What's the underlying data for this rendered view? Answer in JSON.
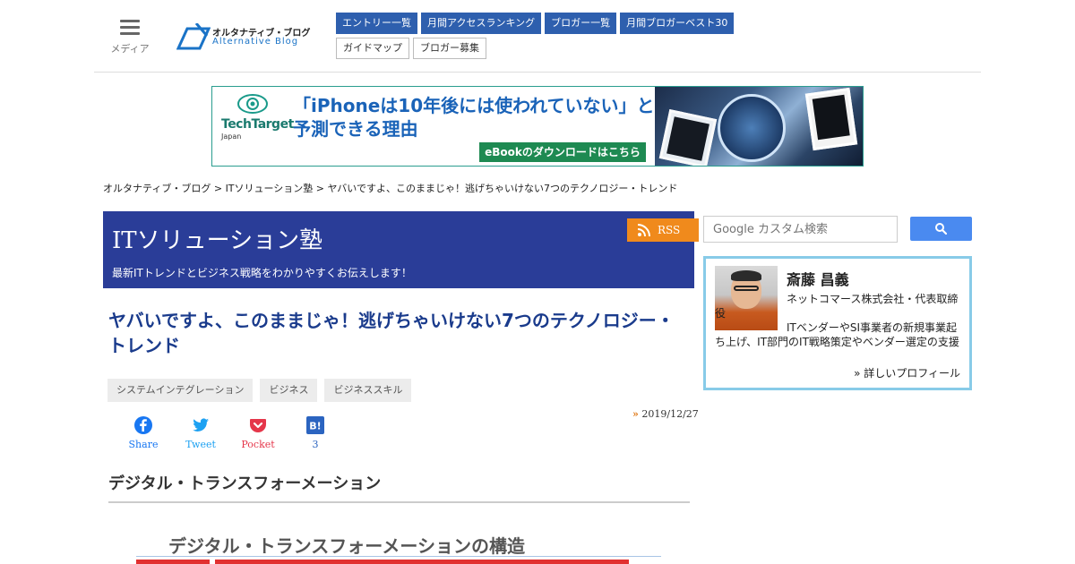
{
  "header": {
    "menu_label": "メディア",
    "logo_jp": "オルタナティブ・ブログ",
    "logo_en": "Alternative Blog",
    "nav_primary": [
      "エントリー一覧",
      "月間アクセスランキング",
      "ブロガー一覧",
      "月間ブロガーベスト30"
    ],
    "nav_secondary": [
      "ガイドマップ",
      "ブロガー募集"
    ]
  },
  "banner": {
    "brand": "TechTarget",
    "brand_sub": "Japan",
    "headline_line1": "「iPhoneは10年後には使われていない」と",
    "headline_line2": "予測できる理由",
    "cta": "eBookのダウンロードはこちら"
  },
  "breadcrumb": {
    "home": "オルタナティブ・ブログ",
    "sep": " > ",
    "blog": "ITソリューション塾",
    "current": "ヤバいですよ、このままじゃ！逃げちゃいけない7つのテクノロジー・トレンド"
  },
  "blog": {
    "title": "ITソリューション塾",
    "description": "最新ITトレンドとビジネス戦略をわかりやすくお伝えします！",
    "rss_label": "RSS"
  },
  "article": {
    "title": "ヤバいですよ、このままじゃ！逃げちゃいけない7つのテクノロジー・トレンド",
    "tags": [
      "システムインテグレーション",
      "ビジネス",
      "ビジネススキル"
    ],
    "date_mark": "»",
    "date": "2019/12/27",
    "share": {
      "facebook": "Share",
      "twitter": "Tweet",
      "pocket": "Pocket",
      "hatena_icon": "B!",
      "hatena_count": "3"
    },
    "section_heading": "デジタル・トランスフォーメーション",
    "figure_title": "デジタル・トランスフォーメーションの構造"
  },
  "sidebar": {
    "search_placeholder": "Google カスタム検索",
    "profile": {
      "name": "斎藤 昌義",
      "bio": [
        "ネットコマース株式会社・代表取締役",
        "ITベンダーやSI事業者の新規事業起ち上げ、IT部門のIT戦略策定やベンダー選定の支援"
      ],
      "link": "» 詳しいプロフィール"
    }
  },
  "colors": {
    "nav_primary": "#2e5fae",
    "blog_header": "#2a3d98",
    "rss": "#f08a1c",
    "article_title": "#1a3b8c",
    "profile_border": "#88cbe8",
    "banner_cta": "#1e8a52"
  },
  "icons": [
    "hamburger-icon",
    "rss-icon",
    "facebook-icon",
    "twitter-icon",
    "pocket-icon",
    "hatena-icon",
    "search-icon"
  ]
}
